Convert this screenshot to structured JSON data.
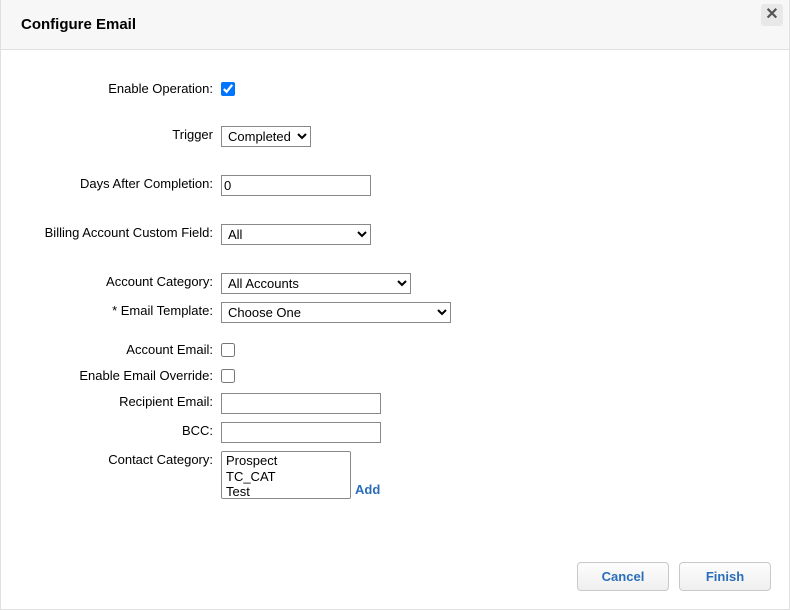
{
  "header": {
    "title": "Configure Email"
  },
  "form": {
    "enable_operation": {
      "label": "Enable Operation:",
      "checked": true
    },
    "trigger": {
      "label": "Trigger",
      "value": "Completed",
      "options": [
        "Completed"
      ]
    },
    "days_after": {
      "label": "Days After Completion:",
      "value": "0"
    },
    "billing_custom_field": {
      "label": "Billing Account Custom Field:",
      "value": "All",
      "options": [
        "All"
      ]
    },
    "account_category": {
      "label": "Account Category:",
      "value": "All Accounts",
      "options": [
        "All Accounts"
      ]
    },
    "email_template": {
      "label": "* Email Template:",
      "value": "Choose One",
      "options": [
        "Choose One"
      ]
    },
    "account_email": {
      "label": "Account Email:",
      "checked": false
    },
    "enable_email_override": {
      "label": "Enable Email Override:",
      "checked": false
    },
    "recipient_email": {
      "label": "Recipient Email:",
      "value": ""
    },
    "bcc": {
      "label": "BCC:",
      "value": ""
    },
    "contact_category": {
      "label": "Contact Category:",
      "options": [
        "Prospect",
        "TC_CAT",
        "Test"
      ],
      "add_label": "Add"
    }
  },
  "footer": {
    "cancel": "Cancel",
    "finish": "Finish"
  }
}
